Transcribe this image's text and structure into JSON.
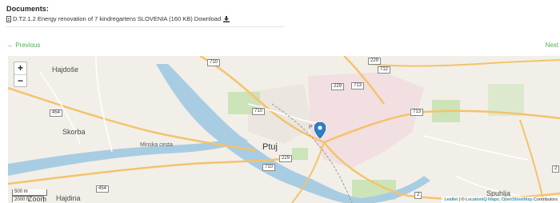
{
  "documents": {
    "title": "Documents:",
    "file_label": "D.T2.1.2 Energy renovation of 7 kindregartens SLOVENIA (160 KB) Download"
  },
  "nav": {
    "previous": "← Previous",
    "next": "Next"
  },
  "map": {
    "places": {
      "hajdose": "Hajdoše",
      "skorba": "Skorba",
      "ptuj": "Ptuj",
      "spuhlja": "Spuhlja",
      "hajdina": "Hajdina",
      "minska": "Minska cesta",
      "p": "P"
    },
    "roads": [
      "710",
      "229",
      "712",
      "454",
      "229",
      "713",
      "713",
      "710",
      "710",
      "229",
      "2",
      "2",
      "454"
    ],
    "scale_metric": "500 m",
    "scale_imperial": "2000 ft",
    "zoom_level": "Zoom",
    "zoom_in": "+",
    "zoom_out": "−",
    "attribution_leaflet": "Leaflet",
    "attribution_sep": " | © ",
    "attribution_mapquest": "LocationIQ Maps",
    "attribution_comma": ", ",
    "attribution_osm": "OpenStreetMap",
    "attribution_tail": " Contributors"
  },
  "colors": {
    "link_green": "#4caf50",
    "river": "#9fc6df",
    "marker": "#2a81cb"
  }
}
